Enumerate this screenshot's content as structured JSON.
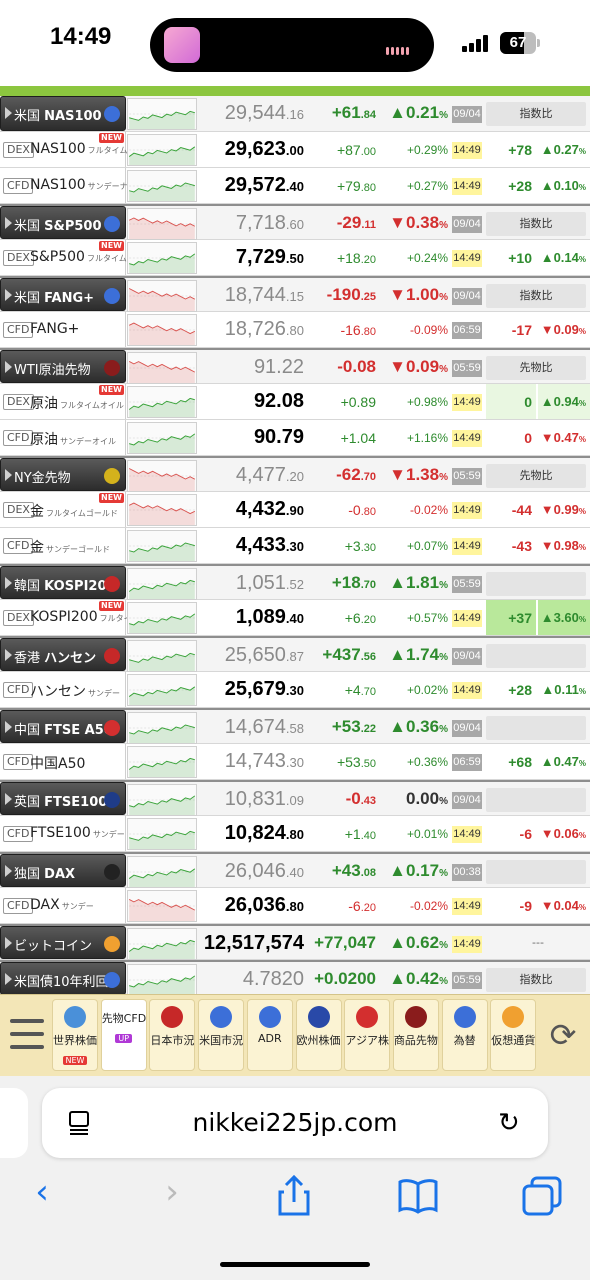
{
  "status_bar": {
    "time": "14:49",
    "battery": "67"
  },
  "rows": [
    {
      "kind": "main",
      "name": "米国",
      "name_b": "NAS100",
      "flag": "#3c6fd8",
      "price_int": "29,544",
      "price_dec": ".16",
      "chg_int": "+61",
      "chg_dec": ".84",
      "pct_int": "▲0.21",
      "pct_unit": "%",
      "dir": "up",
      "time": "09/04",
      "time_style": "gray",
      "cmp": "指数比"
    },
    {
      "kind": "sub",
      "tag": "DEX",
      "name": "NAS100",
      "note": "フルタイムナス",
      "new": "NEW",
      "price_int": "29,623",
      "price_dec": ".00",
      "chg_int": "+87",
      "chg_dec": ".00",
      "pct": "+0.29%",
      "dir": "up",
      "time": "14:49",
      "time_style": "yellow",
      "d1": "+78",
      "d2": "▲0.27",
      "d2u": "%",
      "ddir": "up"
    },
    {
      "kind": "sub",
      "tag": "CFD",
      "name": "NAS100",
      "note": "サンデーナス",
      "price_int": "29,572",
      "price_dec": ".40",
      "chg_int": "+79",
      "chg_dec": ".80",
      "pct": "+0.27%",
      "dir": "up",
      "time": "14:49",
      "time_style": "yellow",
      "d1": "+28",
      "d2": "▲0.10",
      "d2u": "%",
      "ddir": "up"
    },
    {
      "kind": "main",
      "name": "米国",
      "name_b": "S&P500",
      "flag": "#3c6fd8",
      "price_int": "7,718",
      "price_dec": ".60",
      "chg_int": "-29",
      "chg_dec": ".11",
      "pct_int": "▼0.38",
      "pct_unit": "%",
      "dir": "down",
      "time": "09/04",
      "time_style": "gray",
      "cmp": "指数比"
    },
    {
      "kind": "sub",
      "tag": "DEX",
      "name": "S&P500",
      "note": "フルタイムSP",
      "new": "NEW",
      "price_int": "7,729",
      "price_dec": ".50",
      "chg_int": "+18",
      "chg_dec": ".20",
      "pct": "+0.24%",
      "dir": "up",
      "time": "14:49",
      "time_style": "yellow",
      "d1": "+10",
      "d2": "▲0.14",
      "d2u": "%",
      "ddir": "up"
    },
    {
      "kind": "main",
      "name": "米国",
      "name_b": "FANG+",
      "flag": "#3c6fd8",
      "price_int": "18,744",
      "price_dec": ".15",
      "chg_int": "-190",
      "chg_dec": ".25",
      "pct_int": "▼1.00",
      "pct_unit": "%",
      "dir": "down",
      "time": "09/04",
      "time_style": "gray",
      "cmp": "指数比"
    },
    {
      "kind": "sub",
      "tag": "CFD",
      "name": "FANG+",
      "note": "",
      "price_int": "18,726",
      "price_dec": ".80",
      "chg_int": "-16",
      "chg_dec": ".80",
      "pct": "-0.09%",
      "dir": "down",
      "time": "06:59",
      "time_style": "gray",
      "d1": "-17",
      "d2": "▼0.09",
      "d2u": "%",
      "ddir": "down",
      "gray_price": true
    },
    {
      "kind": "main",
      "name": "WTI原油先物",
      "name_b": "",
      "flag": "#8a1c1c",
      "price_int": "91.22",
      "price_dec": "",
      "chg_int": "-0.08",
      "chg_dec": "",
      "pct_int": "▼0.09",
      "pct_unit": "%",
      "dir": "down",
      "time": "05:59",
      "time_style": "gray",
      "cmp": "先物比"
    },
    {
      "kind": "sub",
      "tag": "DEX",
      "name": "原油",
      "note": "フルタイムオイル",
      "new": "NEW",
      "price_int": "92.08",
      "price_dec": "",
      "chg_int": "+0.89",
      "chg_dec": "",
      "pct": "+0.98%",
      "dir": "up",
      "time": "14:49",
      "time_style": "yellow",
      "d1": "0",
      "d2": "▲0.94",
      "d2u": "%",
      "ddir": "up",
      "bg": "greenbg"
    },
    {
      "kind": "sub",
      "tag": "CFD",
      "name": "原油",
      "note": "サンデーオイル",
      "price_int": "90.79",
      "price_dec": "",
      "chg_int": "+1.04",
      "chg_dec": "",
      "pct": "+1.16%",
      "dir": "up",
      "time": "14:49",
      "time_style": "yellow",
      "d1": "0",
      "d2": "▼0.47",
      "d2u": "%",
      "ddir": "down"
    },
    {
      "kind": "main",
      "name": "NY金先物",
      "name_b": "",
      "flag": "#d4b21c",
      "price_int": "4,477",
      "price_dec": ".20",
      "chg_int": "-62",
      "chg_dec": ".70",
      "pct_int": "▼1.38",
      "pct_unit": "%",
      "dir": "down",
      "time": "05:59",
      "time_style": "gray",
      "cmp": "先物比"
    },
    {
      "kind": "sub",
      "tag": "DEX",
      "name": "金",
      "note": "フルタイムゴールド",
      "new": "NEW",
      "price_int": "4,432",
      "price_dec": ".90",
      "chg_int": "-0",
      "chg_dec": ".80",
      "pct": "-0.02%",
      "dir": "down",
      "time": "14:49",
      "time_style": "yellow",
      "d1": "-44",
      "d2": "▼0.99",
      "d2u": "%",
      "ddir": "down"
    },
    {
      "kind": "sub",
      "tag": "CFD",
      "name": "金",
      "note": "サンデーゴールド",
      "price_int": "4,433",
      "price_dec": ".30",
      "chg_int": "+3",
      "chg_dec": ".30",
      "pct": "+0.07%",
      "dir": "up",
      "time": "14:49",
      "time_style": "yellow",
      "d1": "-43",
      "d2": "▼0.98",
      "d2u": "%",
      "ddir": "down"
    },
    {
      "kind": "main",
      "name": "韓国",
      "name_b": "KOSPI200",
      "flag": "#c62828",
      "price_int": "1,051",
      "price_dec": ".52",
      "chg_int": "+18",
      "chg_dec": ".70",
      "pct_int": "▲1.81",
      "pct_unit": "%",
      "dir": "up",
      "time": "05:59",
      "time_style": "gray",
      "cmp": ""
    },
    {
      "kind": "sub",
      "tag": "DEX",
      "name": "KOSPI200",
      "note": "フルタイム",
      "new": "NEW",
      "price_int": "1,089",
      "price_dec": ".40",
      "chg_int": "+6",
      "chg_dec": ".20",
      "pct": "+0.57%",
      "dir": "up",
      "time": "14:49",
      "time_style": "yellow",
      "d1": "+37",
      "d2": "▲3.60",
      "d2u": "%",
      "ddir": "up",
      "bg": "greenbg2"
    },
    {
      "kind": "main",
      "name": "香港",
      "name_b": "ハンセン",
      "flag": "#c62828",
      "price_int": "25,650",
      "price_dec": ".87",
      "chg_int": "+437",
      "chg_dec": ".56",
      "pct_int": "▲1.74",
      "pct_unit": "%",
      "dir": "up",
      "time": "09/04",
      "time_style": "gray",
      "cmp": ""
    },
    {
      "kind": "sub",
      "tag": "CFD",
      "name": "ハンセン",
      "note": "サンデー",
      "price_int": "25,679",
      "price_dec": ".30",
      "chg_int": "+4",
      "chg_dec": ".70",
      "pct": "+0.02%",
      "dir": "up",
      "time": "14:49",
      "time_style": "yellow",
      "d1": "+28",
      "d2": "▲0.11",
      "d2u": "%",
      "ddir": "up"
    },
    {
      "kind": "main",
      "name": "中国",
      "name_b": "FTSE A50",
      "flag": "#d32f2f",
      "price_int": "14,674",
      "price_dec": ".58",
      "chg_int": "+53",
      "chg_dec": ".22",
      "pct_int": "▲0.36",
      "pct_unit": "%",
      "dir": "up",
      "time": "09/04",
      "time_style": "gray",
      "cmp": ""
    },
    {
      "kind": "sub",
      "tag": "CFD",
      "name": "中国A50",
      "note": "",
      "price_int": "14,743",
      "price_dec": ".30",
      "chg_int": "+53",
      "chg_dec": ".50",
      "pct": "+0.36%",
      "dir": "up",
      "time": "06:59",
      "time_style": "gray",
      "d1": "+68",
      "d2": "▲0.47",
      "d2u": "%",
      "ddir": "up",
      "gray_price": true
    },
    {
      "kind": "main",
      "name": "英国",
      "name_b": "FTSE100",
      "flag": "#1f3c88",
      "price_int": "10,831",
      "price_dec": ".09",
      "chg_int": "-0",
      "chg_dec": ".43",
      "pct_int": "0.00",
      "pct_unit": "%",
      "dir": "flat",
      "chgdir": "down",
      "time": "09/04",
      "time_style": "gray",
      "cmp": ""
    },
    {
      "kind": "sub",
      "tag": "CFD",
      "name": "FTSE100",
      "note": "サンデー",
      "price_int": "10,824",
      "price_dec": ".80",
      "chg_int": "+1",
      "chg_dec": ".40",
      "pct": "+0.01%",
      "dir": "up",
      "time": "14:49",
      "time_style": "yellow",
      "d1": "-6",
      "d2": "▼0.06",
      "d2u": "%",
      "ddir": "down"
    },
    {
      "kind": "main",
      "name": "独国",
      "name_b": "DAX",
      "flag": "#222222",
      "price_int": "26,046",
      "price_dec": ".40",
      "chg_int": "+43",
      "chg_dec": ".08",
      "pct_int": "▲0.17",
      "pct_unit": "%",
      "dir": "up",
      "time": "00:38",
      "time_style": "gray",
      "cmp": ""
    },
    {
      "kind": "sub",
      "tag": "CFD",
      "name": "DAX",
      "note": "サンデー",
      "price_int": "26,036",
      "price_dec": ".80",
      "chg_int": "-6",
      "chg_dec": ".20",
      "pct": "-0.02%",
      "dir": "down",
      "time": "14:49",
      "time_style": "yellow",
      "d1": "-9",
      "d2": "▼0.04",
      "d2u": "%",
      "ddir": "down"
    },
    {
      "kind": "main",
      "name": "ビットコイン",
      "name_b": "",
      "flag": "#f0a030",
      "price_int": "12,517,574",
      "price_dec": "",
      "chg_int": "+77,047",
      "chg_dec": "",
      "pct_int": "▲0.62",
      "pct_unit": "%",
      "dir": "up",
      "time": "14:49",
      "time_style": "yellow",
      "cmp": "",
      "dash": "---",
      "dark_price": true
    },
    {
      "kind": "main",
      "name": "米国債10年利回り",
      "name_b": "",
      "flag": "#3c6fd8",
      "price_int": "4.7820",
      "price_dec": "",
      "chg_int": "+0.0200",
      "chg_dec": "",
      "pct_int": "▲0.42",
      "pct_unit": "%",
      "dir": "up",
      "time": "05:59",
      "time_style": "gray",
      "cmp": "指数比"
    }
  ],
  "tabs": [
    {
      "label": "世界株価",
      "badge": "NEW",
      "icon": "globe-icon"
    },
    {
      "label": "先物CFD",
      "badge": "UP",
      "icon": "",
      "active": true
    },
    {
      "label": "日本市況",
      "badge": "",
      "icon": "japan-flag-icon"
    },
    {
      "label": "米国市況",
      "badge": "",
      "icon": "us-flag-icon"
    },
    {
      "label": "ADR",
      "badge": "",
      "icon": "us-flag-icon"
    },
    {
      "label": "欧州株価",
      "badge": "",
      "icon": "eu-flag-icon"
    },
    {
      "label": "アジア株",
      "badge": "",
      "icon": "china-flag-icon"
    },
    {
      "label": "商品先物",
      "badge": "",
      "icon": "oil-drop-icon"
    },
    {
      "label": "為替",
      "badge": "",
      "icon": "currency-icon"
    },
    {
      "label": "仮想通貨",
      "badge": "",
      "icon": "bitcoin-icon"
    }
  ],
  "browser": {
    "url": "nikkei225jp.com"
  }
}
